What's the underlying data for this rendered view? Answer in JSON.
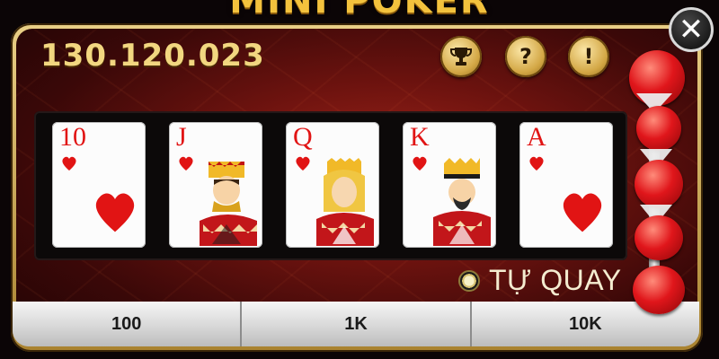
{
  "game": {
    "title": "MINI POKER"
  },
  "balance": "130.120.023",
  "buttons": {
    "trophy_icon": "trophy-icon",
    "help_label": "?",
    "info_label": "!",
    "close_label": "✕"
  },
  "cards": [
    {
      "rank": "10",
      "suit": "hearts",
      "face": false
    },
    {
      "rank": "J",
      "suit": "hearts",
      "face": true
    },
    {
      "rank": "Q",
      "suit": "hearts",
      "face": true
    },
    {
      "rank": "K",
      "suit": "hearts",
      "face": true
    },
    {
      "rank": "A",
      "suit": "hearts",
      "face": false
    }
  ],
  "auto_spin": {
    "label": "TỰ QUAY",
    "checked": true
  },
  "bets": [
    "100",
    "1K",
    "10K"
  ],
  "colors": {
    "gold": "#f3c23d",
    "suit_red": "#e11414",
    "panel_red": "#6e130f"
  }
}
